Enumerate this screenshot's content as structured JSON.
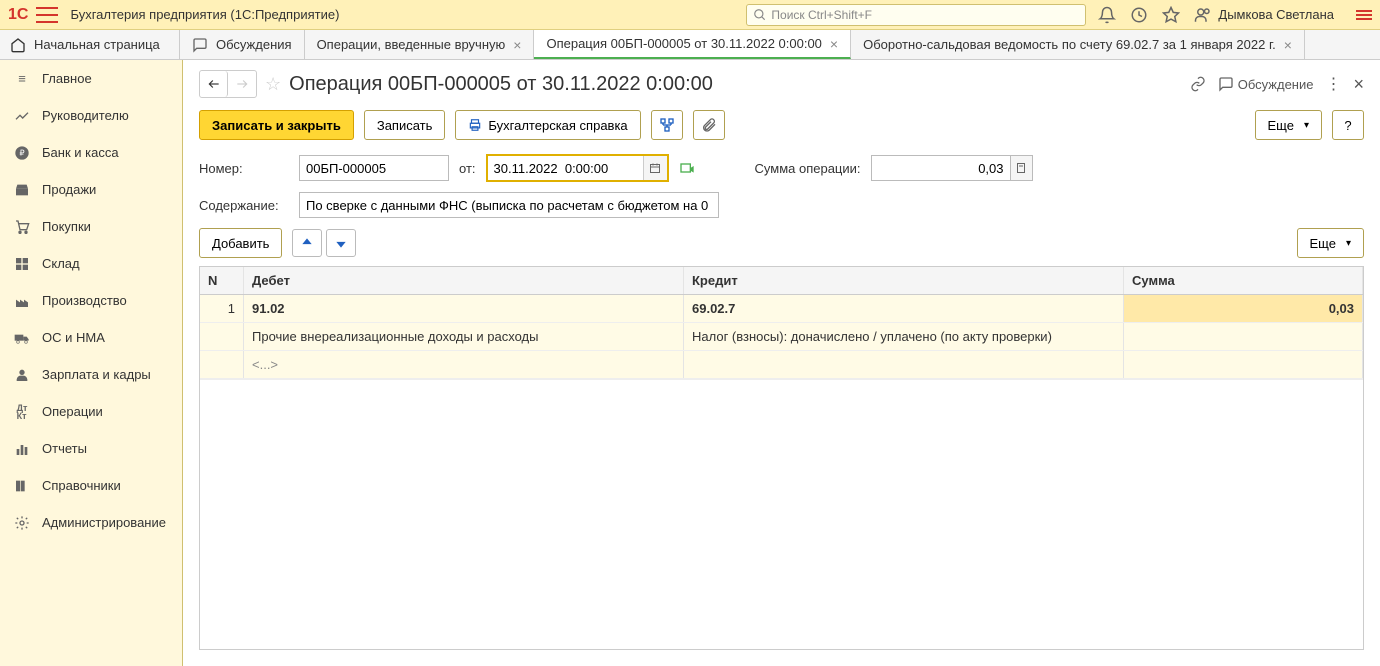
{
  "topbar": {
    "app_title": "Бухгалтерия предприятия  (1С:Предприятие)",
    "search_placeholder": "Поиск Ctrl+Shift+F",
    "user_name": "Дымкова Светлана"
  },
  "tabs": {
    "home": "Начальная страница",
    "discussions": "Обсуждения",
    "manual_ops": "Операции, введенные вручную",
    "active": "Операция 00БП-000005 от 30.11.2022 0:00:00",
    "report": "Оборотно-сальдовая ведомость по счету 69.02.7 за 1 января 2022 г."
  },
  "sidebar": {
    "items": [
      "Главное",
      "Руководителю",
      "Банк и касса",
      "Продажи",
      "Покупки",
      "Склад",
      "Производство",
      "ОС и НМА",
      "Зарплата и кадры",
      "Операции",
      "Отчеты",
      "Справочники",
      "Администрирование"
    ]
  },
  "page": {
    "title": "Операция 00БП-000005 от 30.11.2022 0:00:00",
    "discussion_label": "Обсуждение"
  },
  "toolbar": {
    "save_close": "Записать и закрыть",
    "save": "Записать",
    "report_btn": "Бухгалтерская справка",
    "more": "Еще",
    "help": "?"
  },
  "form": {
    "number_label": "Номер:",
    "number_value": "00БП-000005",
    "date_label": "от:",
    "date_value": "30.11.2022  0:00:00",
    "sum_label": "Сумма операции:",
    "sum_value": "0,03",
    "content_label": "Содержание:",
    "content_value": "По сверке с данными ФНС (выписка по расчетам с бюджетом на 0"
  },
  "table_toolbar": {
    "add": "Добавить",
    "more": "Еще"
  },
  "table": {
    "headers": {
      "n": "N",
      "debit": "Дебет",
      "credit": "Кредит",
      "sum": "Сумма"
    },
    "row": {
      "n": "1",
      "debit_account": "91.02",
      "credit_account": "69.02.7",
      "sum": "0,03",
      "debit_desc": "Прочие внереализационные доходы и расходы",
      "credit_desc": "Налог (взносы): доначислено / уплачено (по акту проверки)",
      "placeholder": "<...>"
    }
  }
}
